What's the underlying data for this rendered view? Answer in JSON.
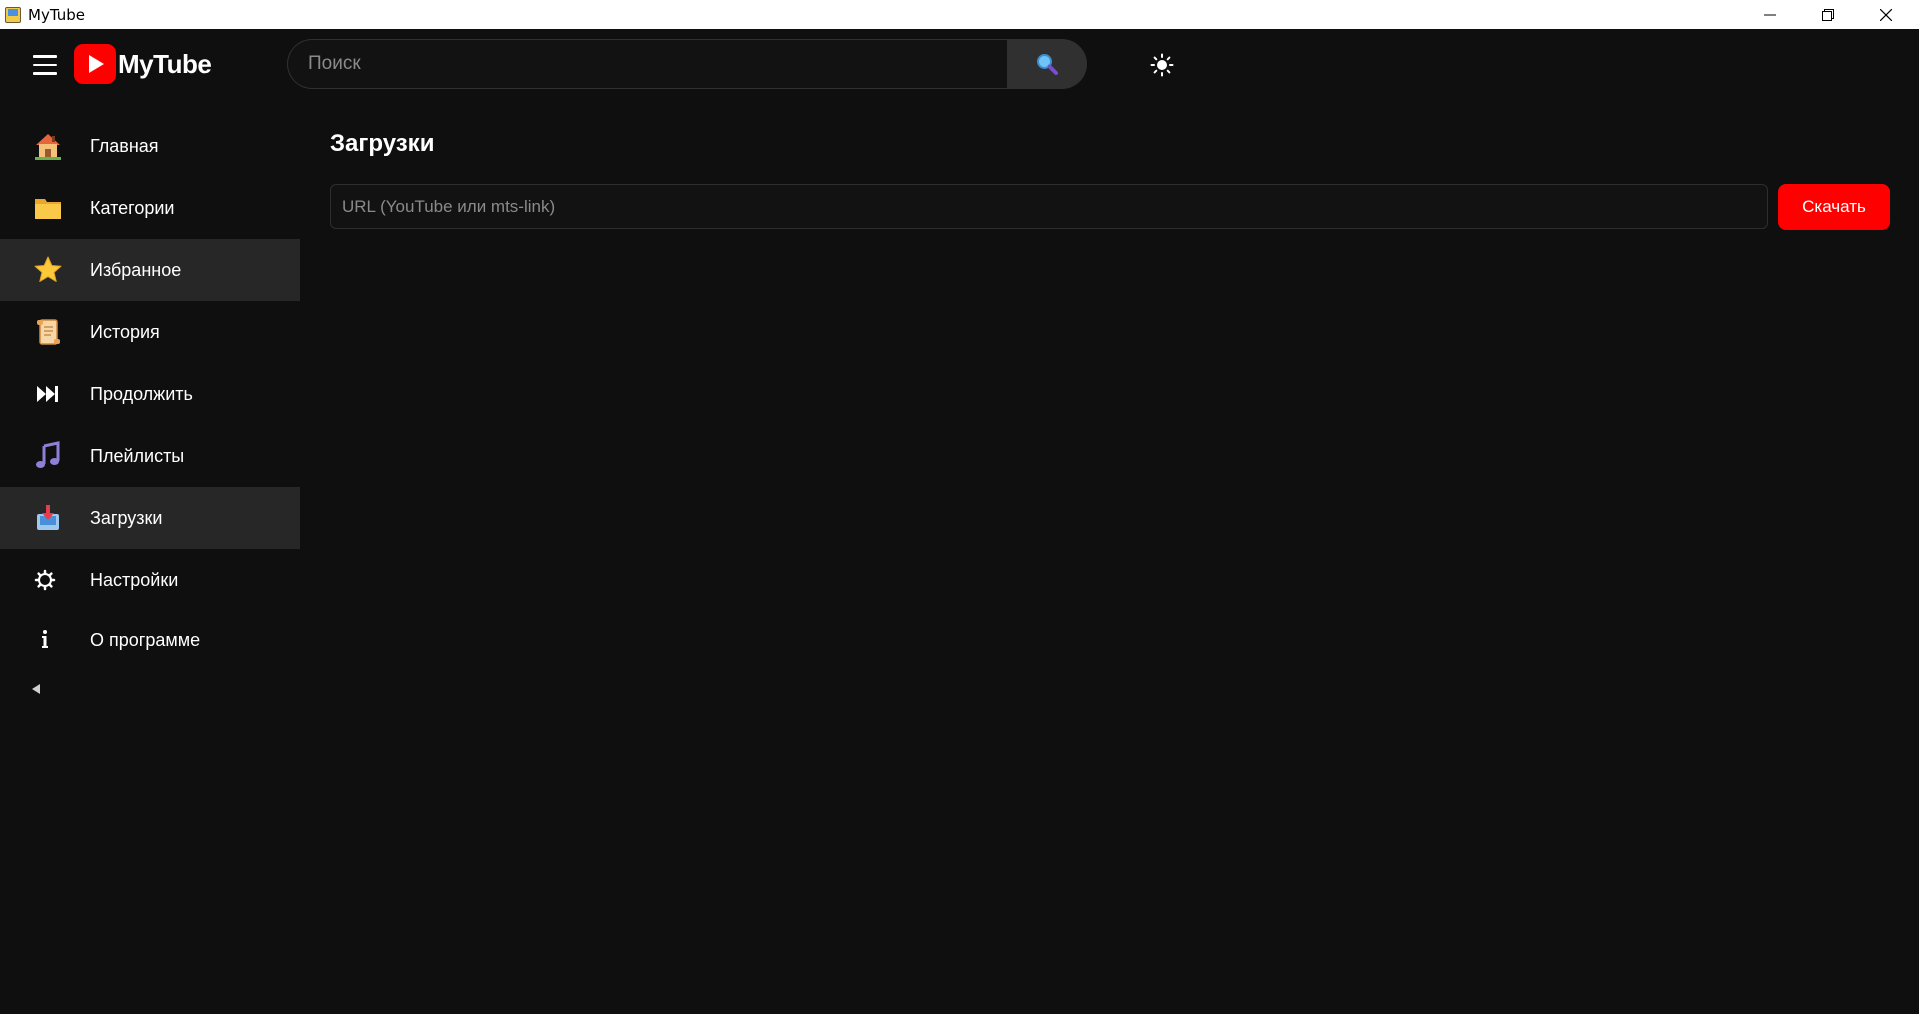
{
  "window": {
    "title": "MyTube",
    "minimize_icon": "minimize-icon",
    "maximize_icon": "restore-icon",
    "close_icon": "close-icon"
  },
  "header": {
    "menu_icon": "hamburger-menu-icon",
    "logo_text": "MyTube",
    "search": {
      "placeholder": "Поиск",
      "value": "",
      "button_icon": "magnifier-icon"
    },
    "theme_icon": "sun-icon"
  },
  "sidebar": {
    "items": [
      {
        "label": "Главная",
        "icon": "house-icon",
        "active": false
      },
      {
        "label": "Категории",
        "icon": "folder-icon",
        "active": false
      },
      {
        "label": "Избранное",
        "icon": "star-icon",
        "active": true
      },
      {
        "label": "История",
        "icon": "scroll-icon",
        "active": false
      },
      {
        "label": "Продолжить",
        "icon": "next-track-icon",
        "active": false
      },
      {
        "label": "Плейлисты",
        "icon": "music-note-icon",
        "active": false
      },
      {
        "label": "Загрузки",
        "icon": "inbox-download-icon",
        "active": true
      },
      {
        "label": "Настройки",
        "icon": "gear-icon",
        "active": false
      },
      {
        "label": "О программе",
        "icon": "info-icon",
        "active": false
      }
    ],
    "collapse_icon": "collapse-left-icon"
  },
  "main": {
    "title": "Загрузки",
    "url_input": {
      "placeholder": "URL (YouTube или mts-link)",
      "value": ""
    },
    "download_label": "Скачать"
  },
  "colors": {
    "background": "#0f0f0f",
    "active_item": "#272727",
    "accent": "#ff0000"
  }
}
